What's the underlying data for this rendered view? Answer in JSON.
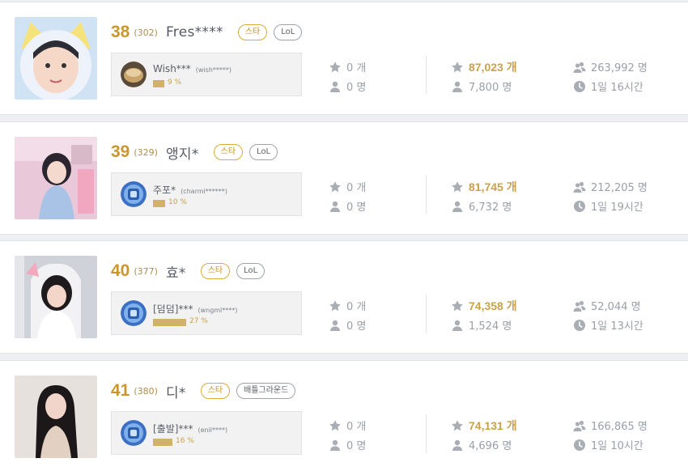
{
  "colors": {
    "accent": "#c9972e",
    "gold_value": "#c9a14b",
    "muted": "#9aa0a8",
    "bar": "#d2b269"
  },
  "rows": [
    {
      "rank": "38",
      "prev_rank": "(302)",
      "name": "Fres****",
      "badges": [
        "스타",
        "LoL"
      ],
      "thumbnail_icon": "streamer-thumbnail",
      "top_fan": {
        "name": "Wish***",
        "id": "(wish*****)",
        "percent": "9 %",
        "share": 0.09,
        "avatar_icon": "fan-avatar-bowl"
      },
      "stats": {
        "gift_count": "0 개",
        "fan_count": "0 명",
        "stars": "87,023 개",
        "viewers": "7,800 명",
        "followers": "263,992 명",
        "airtime": "1일 16시간"
      }
    },
    {
      "rank": "39",
      "prev_rank": "(329)",
      "name": "앵지*",
      "badges": [
        "스타",
        "LoL"
      ],
      "thumbnail_icon": "streamer-thumbnail",
      "top_fan": {
        "name": "주포*",
        "id": "(charmi******)",
        "percent": "10 %",
        "share": 0.1,
        "avatar_icon": "fan-avatar-blue"
      },
      "stats": {
        "gift_count": "0 개",
        "fan_count": "0 명",
        "stars": "81,745 개",
        "viewers": "6,732 명",
        "followers": "212,205 명",
        "airtime": "1일 19시간"
      }
    },
    {
      "rank": "40",
      "prev_rank": "(377)",
      "name": "효*",
      "badges": [
        "스타",
        "LoL"
      ],
      "thumbnail_icon": "streamer-thumbnail",
      "top_fan": {
        "name": "[덤덤]***",
        "id": "(wngml****)",
        "percent": "27 %",
        "share": 0.27,
        "avatar_icon": "fan-avatar-blue"
      },
      "stats": {
        "gift_count": "0 개",
        "fan_count": "0 명",
        "stars": "74,358 개",
        "viewers": "1,524 명",
        "followers": "52,044 명",
        "airtime": "1일 13시간"
      }
    },
    {
      "rank": "41",
      "prev_rank": "(380)",
      "name": "디*",
      "badges": [
        "스타",
        "배틀그라운드"
      ],
      "thumbnail_icon": "streamer-thumbnail",
      "top_fan": {
        "name": "[출발]***",
        "id": "(enil****)",
        "percent": "16 %",
        "share": 0.16,
        "avatar_icon": "fan-avatar-blue"
      },
      "stats": {
        "gift_count": "0 개",
        "fan_count": "0 명",
        "stars": "74,131 개",
        "viewers": "4,696 명",
        "followers": "166,865 명",
        "airtime": "1일 10시간"
      }
    }
  ]
}
